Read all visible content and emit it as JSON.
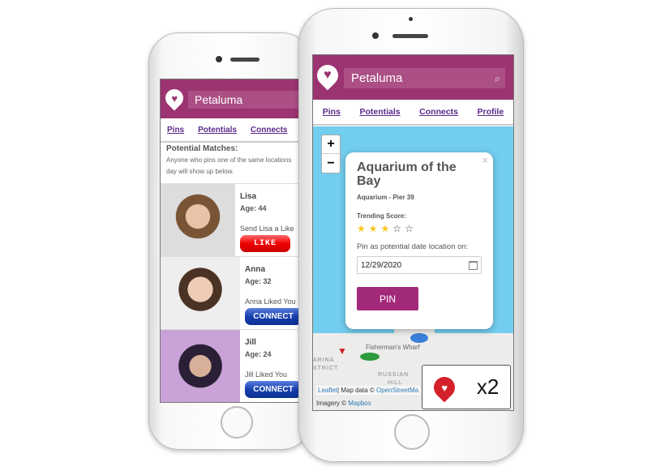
{
  "app": {
    "search_value": "Petaluma",
    "brand_color": "#9b3470"
  },
  "left_phone": {
    "nav": [
      "Pins",
      "Potentials",
      "Connects"
    ],
    "heading": "Potential Matches:",
    "description": "Anyone who pins one of the same locations day will show up below.",
    "matches": [
      {
        "name": "Lisa",
        "age": "Age: 44",
        "message": "Send Lisa a Like",
        "button": "LIKE"
      },
      {
        "name": "Anna",
        "age": "Age: 32",
        "message": "Anna Liked You",
        "button": "CONNECT"
      },
      {
        "name": "Jill",
        "age": "Age: 24",
        "message": "Jill Liked You",
        "button": "CONNECT"
      }
    ]
  },
  "right_phone": {
    "nav": [
      "Pins",
      "Potentials",
      "Connects",
      "Profile"
    ],
    "zoom_in": "+",
    "zoom_out": "−",
    "popup": {
      "title": "Aquarium of the Bay",
      "subtitle": "Aquarium - Pier 39",
      "trending_label": "Trending Score:",
      "stars": 3,
      "stars_max": 5,
      "pin_label": "Pin as potential date location on:",
      "date": "12/29/2020",
      "pin_button": "PIN",
      "close": "×"
    },
    "map_labels": {
      "wharf": "Fisherman's Wharf",
      "marina": "ARINA",
      "district": "STRICT",
      "russian": "RUSSIAN",
      "hill": "HILL"
    },
    "attribution": {
      "leaflet": "Leaflet",
      "map_data": "| Map data © ",
      "osm": "OpenStreetMa",
      "imagery": "Imagery © ",
      "mapbox": "Mapbox"
    },
    "badge": "x2"
  }
}
